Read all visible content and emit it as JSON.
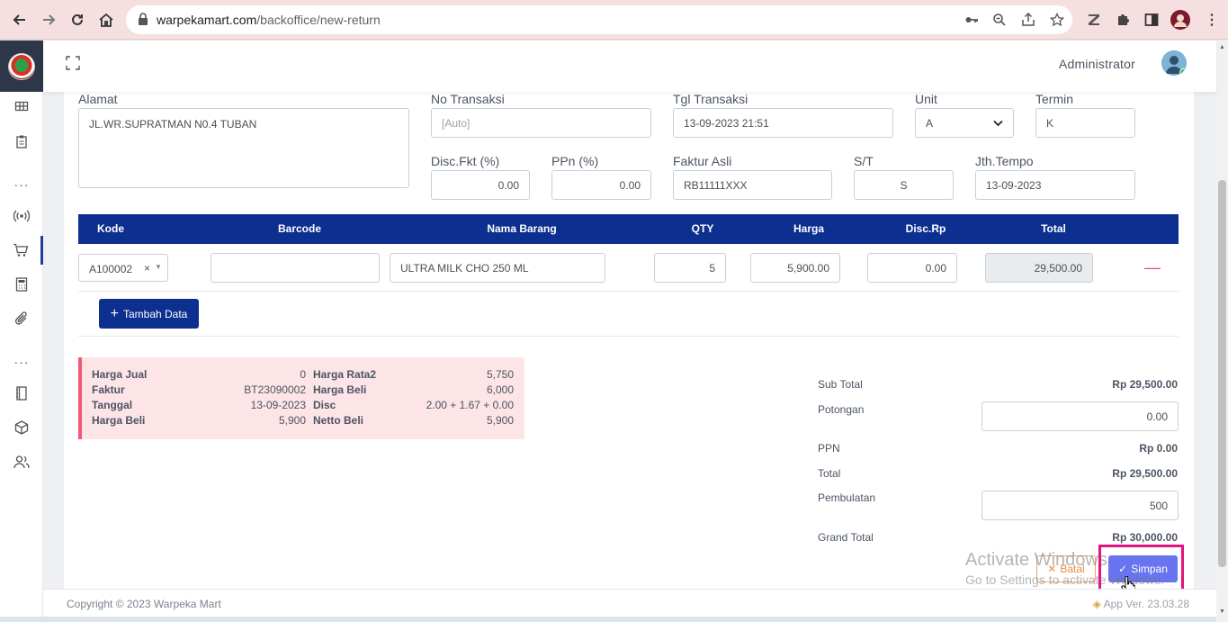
{
  "browser": {
    "url_host": "warpekamart.com",
    "url_path": "/backoffice/new-return"
  },
  "header": {
    "user_name": "Administrator"
  },
  "form": {
    "alamat_label": "Alamat",
    "alamat_value": "JL.WR.SUPRATMAN N0.4 TUBAN",
    "no_transaksi_label": "No Transaksi",
    "no_transaksi_placeholder": "[Auto]",
    "tgl_transaksi_label": "Tgl Transaksi",
    "tgl_transaksi_value": "13-09-2023 21:51",
    "unit_label": "Unit",
    "unit_value": "A",
    "termin_label": "Termin",
    "termin_value": "K",
    "disc_fkt_label": "Disc.Fkt (%)",
    "disc_fkt_value": "0.00",
    "ppn_label": "PPn (%)",
    "ppn_value": "0.00",
    "faktur_asli_label": "Faktur Asli",
    "faktur_asli_value": "RB11111XXX",
    "st_label": "S/T",
    "st_value": "S",
    "jth_tempo_label": "Jth.Tempo",
    "jth_tempo_value": "13-09-2023"
  },
  "table": {
    "headers": [
      "Kode",
      "Barcode",
      "Nama Barang",
      "QTY",
      "Harga",
      "Disc.Rp",
      "Total"
    ],
    "rows": [
      {
        "kode": "A100002",
        "barcode": "",
        "nama_barang": "ULTRA MILK CHO 250 ML",
        "qty": "5",
        "harga": "5,900.00",
        "disc_rp": "0.00",
        "total": "29,500.00"
      }
    ],
    "add_button": "Tambah Data"
  },
  "info": {
    "harga_jual_label": "Harga Jual",
    "harga_jual_value": "0",
    "faktur_label": "Faktur",
    "faktur_value": "BT23090002",
    "tanggal_label": "Tanggal",
    "tanggal_value": "13-09-2023",
    "harga_beli_label": "Harga Beli",
    "harga_beli_value": "5,900",
    "harga_rata2_label": "Harga Rata2",
    "harga_rata2_value": "5,750",
    "harga_beli2_label": "Harga Beli",
    "harga_beli2_value": "6,000",
    "disc_label": "Disc",
    "disc_value": "2.00 + 1.67 + 0.00",
    "netto_beli_label": "Netto Beli",
    "netto_beli_value": "5,900"
  },
  "totals": {
    "sub_total_label": "Sub Total",
    "sub_total_value": "Rp 29,500.00",
    "potongan_label": "Potongan",
    "potongan_value": "0.00",
    "ppn_label": "PPN",
    "ppn_value": "Rp 0.00",
    "total_label": "Total",
    "total_value": "Rp 29,500.00",
    "pembulatan_label": "Pembulatan",
    "pembulatan_value": "500",
    "grand_total_label": "Grand Total",
    "grand_total_value": "Rp 30,000.00"
  },
  "actions": {
    "batal_label": "Batal",
    "simpan_label": "Simpan"
  },
  "watermark": {
    "line1": "Activate Windows",
    "line2": "Go to Settings to activate Windows."
  },
  "footer": {
    "copyright": "Copyright © 2023 Warpeka Mart",
    "version": "App Ver. 23.03.28"
  }
}
